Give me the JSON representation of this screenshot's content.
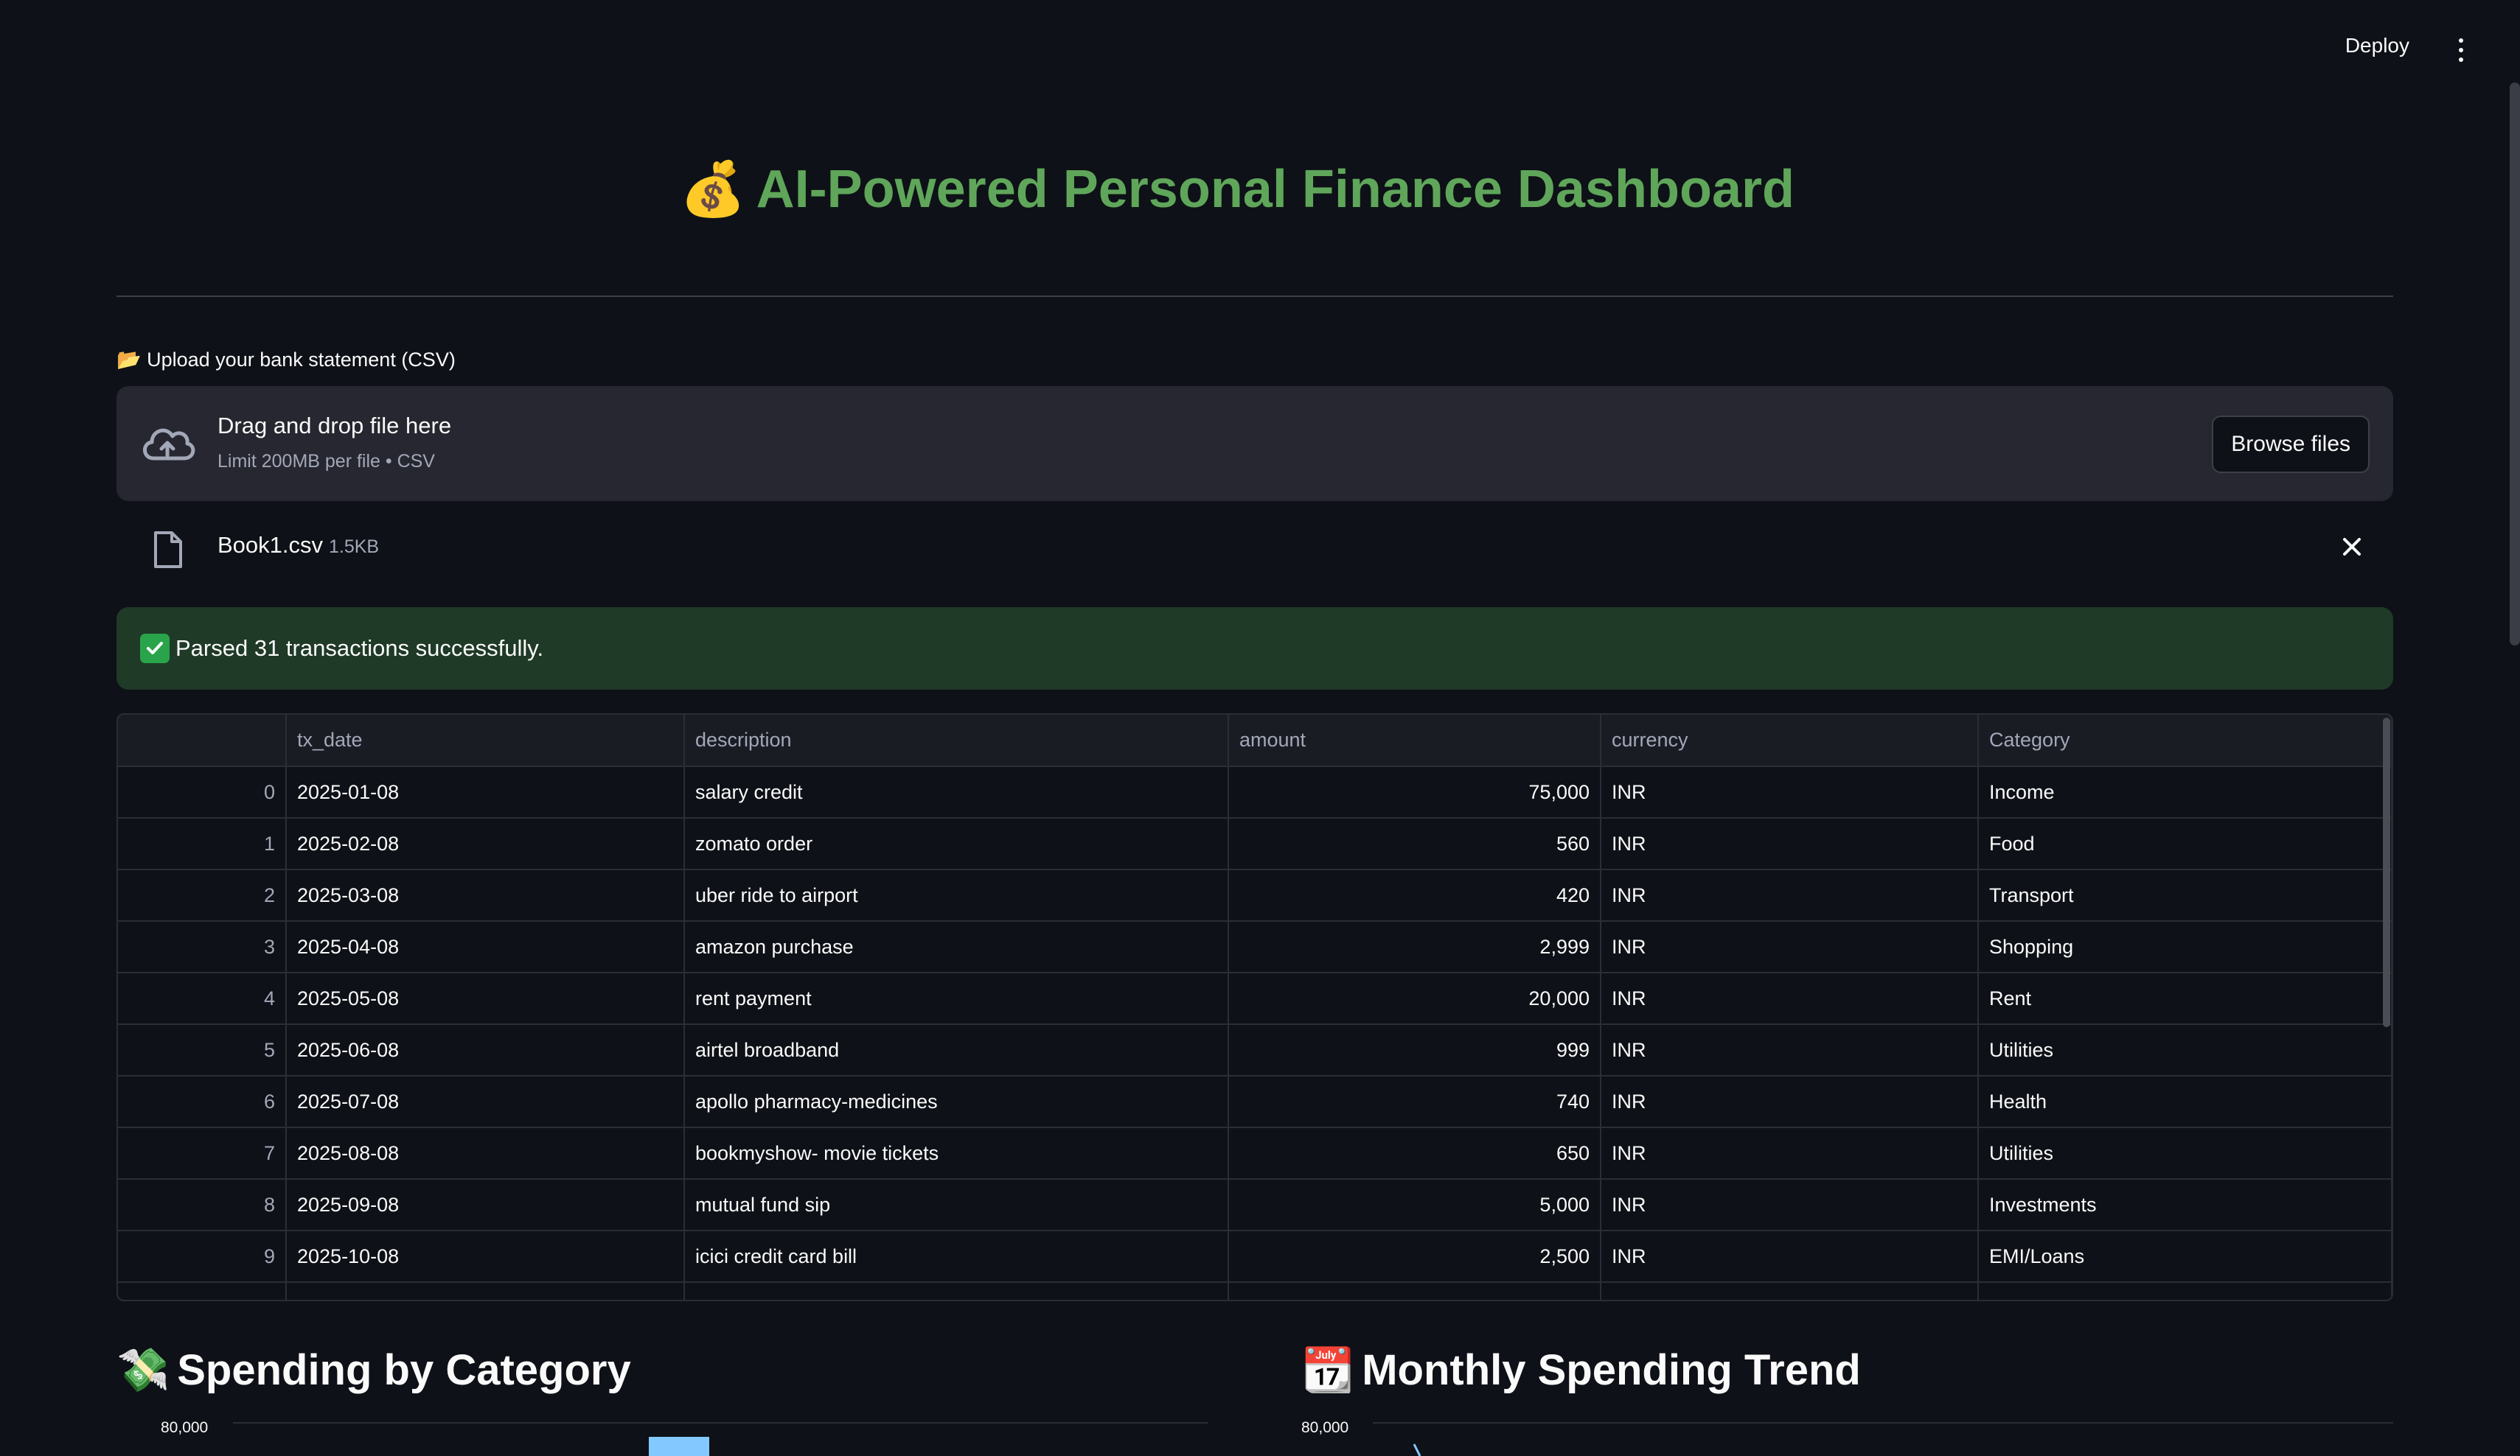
{
  "header": {
    "deploy_label": "Deploy"
  },
  "title": {
    "emoji": "💰",
    "text": "AI-Powered Personal Finance Dashboard"
  },
  "uploader": {
    "label": "📂 Upload your bank statement (CSV)",
    "drop_title": "Drag and drop file here",
    "limit_text": "Limit 200MB per file • CSV",
    "browse_label": "Browse files",
    "file": {
      "name": "Book1.csv",
      "size": "1.5KB"
    }
  },
  "alert": {
    "text": "Parsed 31 transactions successfully.",
    "color": "#1f3a26"
  },
  "table": {
    "columns": [
      "",
      "tx_date",
      "description",
      "amount",
      "currency",
      "Category"
    ],
    "rows": [
      [
        "0",
        "2025-01-08",
        "salary credit",
        "75,000",
        "INR",
        "Income"
      ],
      [
        "1",
        "2025-02-08",
        "zomato order",
        "560",
        "INR",
        "Food"
      ],
      [
        "2",
        "2025-03-08",
        "uber ride to airport",
        "420",
        "INR",
        "Transport"
      ],
      [
        "3",
        "2025-04-08",
        "amazon purchase",
        "2,999",
        "INR",
        "Shopping"
      ],
      [
        "4",
        "2025-05-08",
        "rent payment",
        "20,000",
        "INR",
        "Rent"
      ],
      [
        "5",
        "2025-06-08",
        "airtel broadband",
        "999",
        "INR",
        "Utilities"
      ],
      [
        "6",
        "2025-07-08",
        "apollo pharmacy-medicines",
        "740",
        "INR",
        "Health"
      ],
      [
        "7",
        "2025-08-08",
        "bookmyshow- movie tickets",
        "650",
        "INR",
        "Utilities"
      ],
      [
        "8",
        "2025-09-08",
        "mutual fund sip",
        "5,000",
        "INR",
        "Investments"
      ],
      [
        "9",
        "2025-10-08",
        "icici credit card bill",
        "2,500",
        "INR",
        "EMI/Loans"
      ]
    ]
  },
  "sections": {
    "spending_by_category": {
      "emoji": "💸",
      "title": "Spending by Category",
      "y_tick": "80,000"
    },
    "monthly_trend": {
      "emoji": "📆",
      "title": "Monthly Spending Trend",
      "y_tick": "80,000"
    }
  },
  "colors": {
    "accent_title": "#5fa65a",
    "bar": "#83c9ff",
    "line": "#83c9ff",
    "success": "#2aa44a"
  }
}
